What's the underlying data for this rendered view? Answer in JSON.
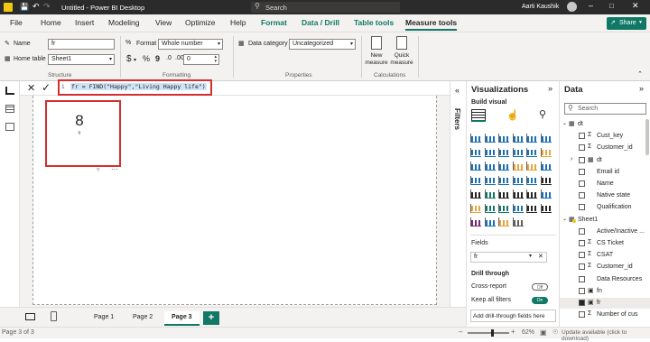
{
  "titlebar": {
    "file_title": "Untitled - Power BI Desktop",
    "search_placeholder": "Search",
    "user_name": "Aarti Kaushik"
  },
  "ribbon_tabs": [
    "File",
    "Home",
    "Insert",
    "Modeling",
    "View",
    "Optimize",
    "Help",
    "Format",
    "Data / Drill",
    "Table tools",
    "Measure tools"
  ],
  "active_tab": "Measure tools",
  "share_label": "Share",
  "structure": {
    "name_label": "Name",
    "name_value": "fr",
    "home_table_label": "Home table",
    "home_table_value": "Sheet1",
    "group_label": "Structure"
  },
  "formatting": {
    "format_label": "Format",
    "format_value": "Whole number",
    "currency_symbol": "$",
    "percent_symbol": "%",
    "comma_symbol": "9",
    "decimals_value": "0",
    "group_label": "Formatting"
  },
  "properties": {
    "data_category_label": "Data category",
    "data_category_value": "Uncategorized",
    "group_label": "Properties"
  },
  "calculations": {
    "new_measure_label": "New measure",
    "quick_measure_label": "Quick measure",
    "group_label": "Calculations"
  },
  "formula_bar": {
    "line_number": "1",
    "formula": "fr = FIND(\"Happy\",\"Living Happy life\")"
  },
  "card_visual": {
    "value": "8",
    "label": "fr"
  },
  "filters_label": "Filters",
  "visualizations": {
    "title": "Visualizations",
    "build_visual_label": "Build visual",
    "fields_label": "Fields",
    "field_well_value": "fr",
    "drill_through_label": "Drill through",
    "cross_report_label": "Cross-report",
    "cross_report_state": "Off",
    "keep_all_filters_label": "Keep all filters",
    "keep_all_filters_state": "On",
    "add_drill_label": "Add drill-through fields here"
  },
  "data_pane": {
    "title": "Data",
    "search_placeholder": "Search",
    "items": [
      {
        "label": "dt",
        "level": 0,
        "kind": "table",
        "checked": false
      },
      {
        "label": "Cust_key",
        "level": 1,
        "kind": "sigma",
        "checked": false
      },
      {
        "label": "Customer_id",
        "level": 1,
        "kind": "sigma",
        "checked": false
      },
      {
        "label": "dt",
        "level": 1,
        "kind": "table",
        "checked": false
      },
      {
        "label": "Email id",
        "level": 1,
        "kind": "none",
        "checked": false
      },
      {
        "label": "Name",
        "level": 1,
        "kind": "none",
        "checked": false
      },
      {
        "label": "Native state",
        "level": 1,
        "kind": "none",
        "checked": false
      },
      {
        "label": "Qualification",
        "level": 1,
        "kind": "none",
        "checked": false
      },
      {
        "label": "Sheet1",
        "level": 0,
        "kind": "table",
        "checked": true
      },
      {
        "label": "Active/Inactive ...",
        "level": 1,
        "kind": "none",
        "checked": false
      },
      {
        "label": "CS Ticket",
        "level": 1,
        "kind": "sigma",
        "checked": false
      },
      {
        "label": "CSAT",
        "level": 1,
        "kind": "sigma",
        "checked": false
      },
      {
        "label": "Customer_id",
        "level": 1,
        "kind": "sigma",
        "checked": false
      },
      {
        "label": "Data Resources",
        "level": 1,
        "kind": "none",
        "checked": false
      },
      {
        "label": "fn",
        "level": 1,
        "kind": "calc",
        "checked": false
      },
      {
        "label": "fr",
        "level": 1,
        "kind": "calc",
        "checked": true
      },
      {
        "label": "Number of cus",
        "level": 1,
        "kind": "sigma",
        "checked": false
      }
    ]
  },
  "pages": {
    "tabs": [
      "Page 1",
      "Page 2",
      "Page 3"
    ],
    "active": "Page 3",
    "add_label": "+"
  },
  "status": {
    "page_indicator": "Page 3 of 3",
    "zoom": "62%",
    "update_text": "Update available (click to download)"
  },
  "colors": {
    "accent": "#117865",
    "highlight_box": "#d32f2f",
    "titlebar": "#2b2b2b"
  }
}
